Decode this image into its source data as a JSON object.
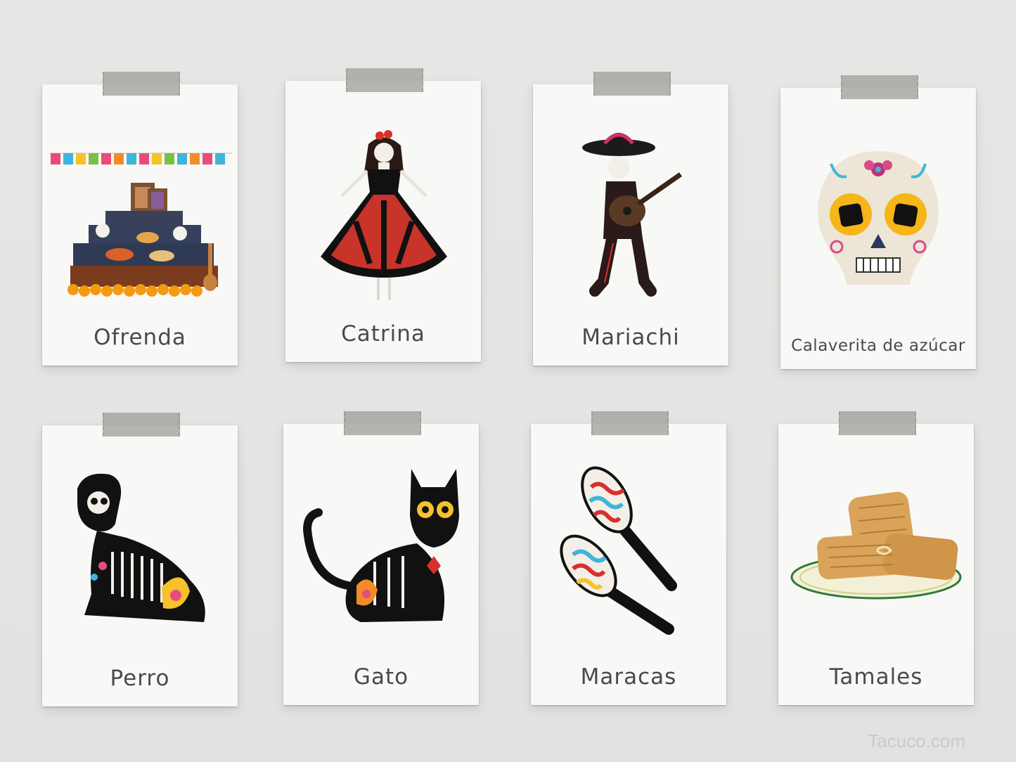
{
  "cards": [
    {
      "label": "Ofrenda",
      "icon": "ofrenda-icon"
    },
    {
      "label": "Catrina",
      "icon": "catrina-icon"
    },
    {
      "label": "Mariachi",
      "icon": "mariachi-icon"
    },
    {
      "label": "Calaverita de azúcar",
      "icon": "sugar-skull-icon"
    },
    {
      "label": "Perro",
      "icon": "dog-icon"
    },
    {
      "label": "Gato",
      "icon": "cat-icon"
    },
    {
      "label": "Maracas",
      "icon": "maracas-icon"
    },
    {
      "label": "Tamales",
      "icon": "tamales-icon"
    }
  ],
  "watermark": "Tacuco.com",
  "colors": {
    "background": "#e4e4e2",
    "card": "#f8f8f6",
    "tape": "#a0a09e",
    "label": "#4a4a4a"
  }
}
